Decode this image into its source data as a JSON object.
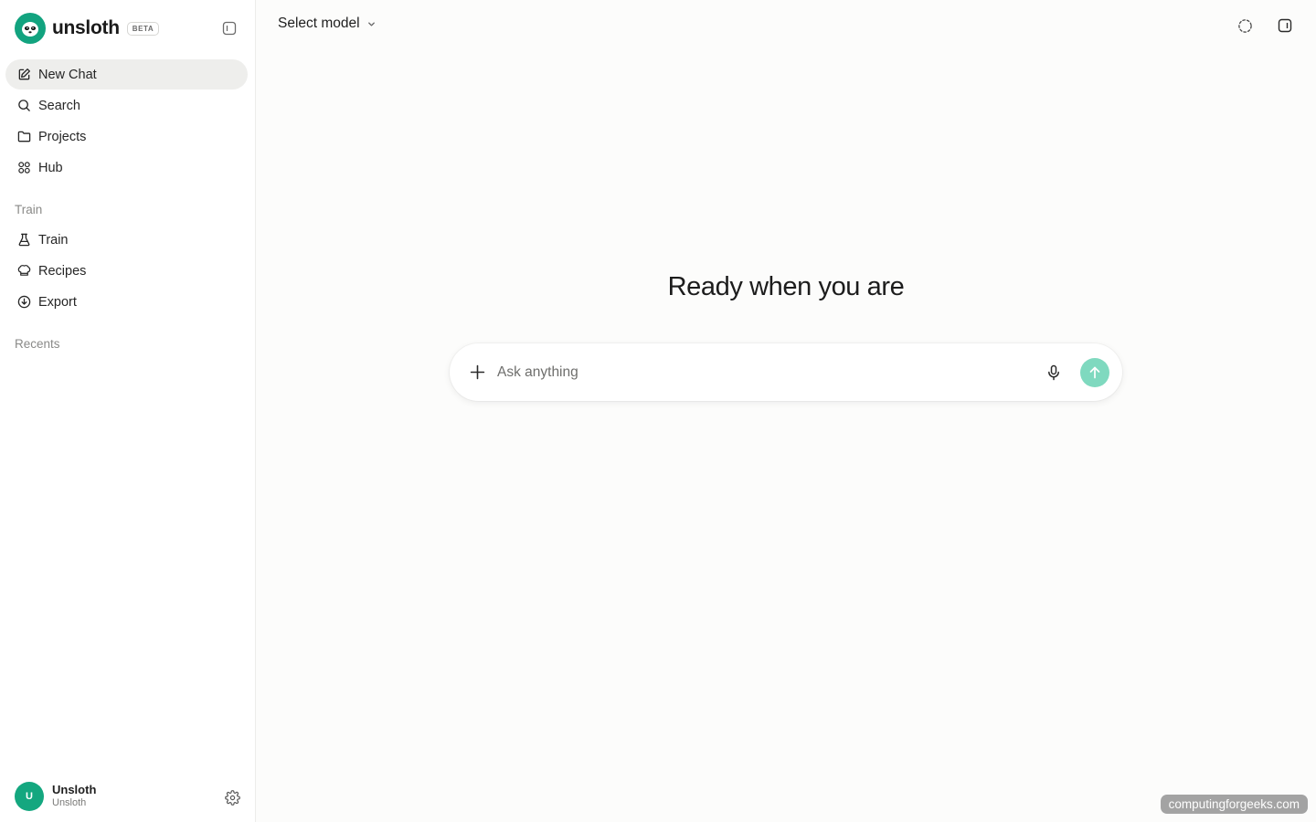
{
  "brand": {
    "name": "unsloth",
    "badge": "BETA"
  },
  "nav": {
    "primary": [
      {
        "label": "New Chat",
        "icon": "edit-icon",
        "active": true
      },
      {
        "label": "Search",
        "icon": "search-icon"
      },
      {
        "label": "Projects",
        "icon": "folder-icon"
      },
      {
        "label": "Hub",
        "icon": "grid-icon"
      }
    ],
    "train_section_label": "Train",
    "train": [
      {
        "label": "Train",
        "icon": "flask-icon"
      },
      {
        "label": "Recipes",
        "icon": "chef-hat-icon"
      },
      {
        "label": "Export",
        "icon": "download-icon"
      }
    ],
    "recents_label": "Recents"
  },
  "user": {
    "initial": "U",
    "name": "Unsloth",
    "subtitle": "Unsloth"
  },
  "header": {
    "model_select": "Select model"
  },
  "main": {
    "headline": "Ready when you are",
    "input_placeholder": "Ask anything"
  },
  "watermark": "computingforgeeks.com",
  "colors": {
    "accent": "#12a37f",
    "send_button": "#7fd9bf",
    "active_nav": "#eeeeec"
  }
}
